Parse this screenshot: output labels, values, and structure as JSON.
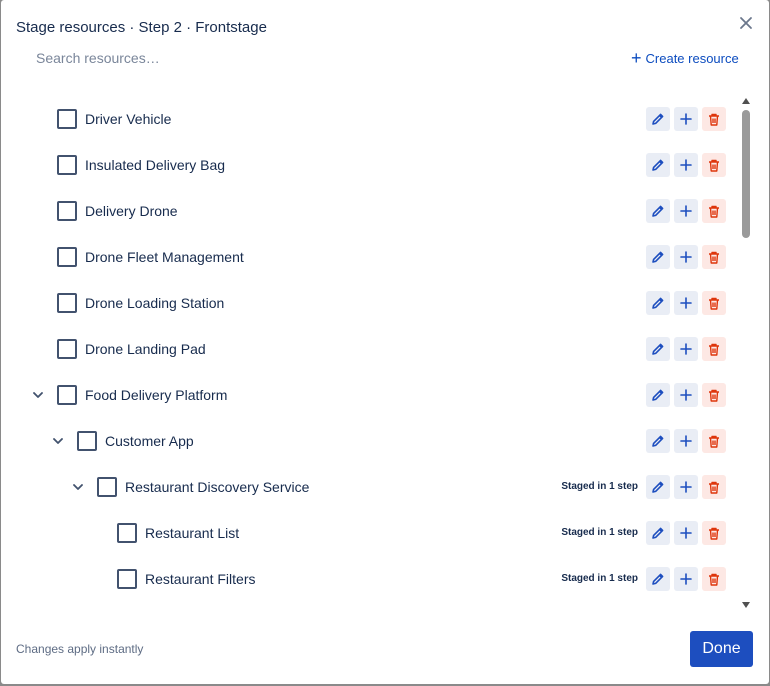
{
  "dialog": {
    "title": "Stage resources · Step 2 · Frontstage",
    "close_icon": "close-icon"
  },
  "search": {
    "placeholder": "Search resources…",
    "value": ""
  },
  "toolbar": {
    "create_label": "Create resource",
    "create_icon": "plus-icon"
  },
  "resources": [
    {
      "label": "Driver Vehicle",
      "depth": 1,
      "expanded": null,
      "staged": ""
    },
    {
      "label": "Insulated Delivery Bag",
      "depth": 1,
      "expanded": null,
      "staged": ""
    },
    {
      "label": "Delivery Drone",
      "depth": 1,
      "expanded": null,
      "staged": ""
    },
    {
      "label": "Drone Fleet Management",
      "depth": 1,
      "expanded": null,
      "staged": ""
    },
    {
      "label": "Drone Loading Station",
      "depth": 1,
      "expanded": null,
      "staged": ""
    },
    {
      "label": "Drone Landing Pad",
      "depth": 1,
      "expanded": null,
      "staged": ""
    },
    {
      "label": "Food Delivery Platform",
      "depth": 1,
      "expanded": true,
      "staged": ""
    },
    {
      "label": "Customer App",
      "depth": 2,
      "expanded": true,
      "staged": ""
    },
    {
      "label": "Restaurant Discovery Service",
      "depth": 3,
      "expanded": true,
      "staged": "Staged in 1 step"
    },
    {
      "label": "Restaurant List",
      "depth": 4,
      "expanded": null,
      "staged": "Staged in 1 step"
    },
    {
      "label": "Restaurant Filters",
      "depth": 4,
      "expanded": null,
      "staged": "Staged in 1 step"
    }
  ],
  "row_actions": {
    "edit_icon": "pencil-icon",
    "add_icon": "plus-icon",
    "delete_icon": "trash-icon"
  },
  "colors": {
    "accent": "#1d4ebf",
    "link": "#0c4cbf",
    "danger": "#de350b",
    "edit_bg": "#e9edf5",
    "delete_bg": "#fde8e4"
  },
  "footer": {
    "hint": "Changes apply instantly",
    "done_label": "Done"
  }
}
